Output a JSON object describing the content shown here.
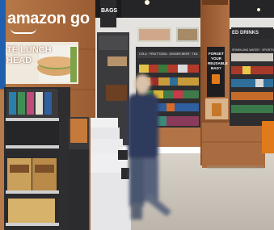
{
  "store_sign": {
    "brand": "amazon go"
  },
  "menu_board": {
    "line1": "TE LUNCH",
    "line2": "HEAD"
  },
  "wall_labels": {
    "bags": "BAGS",
    "drinks_center": "COLA · FRUIT SODA · GINGER BEER · TEA",
    "drinks_right": "SPARKLING WATER · SPORTS",
    "drinks_corner": "ED DRINKS"
  },
  "promo_poster": {
    "line1": "FORGET",
    "line2": "YOUR",
    "line3": "REUSABLE",
    "line4": "BAG?"
  },
  "colors": {
    "wood": "#a8683c",
    "ceiling": "#1c1c1e",
    "floor": "#c9c2b8",
    "gate": "#e9e9ea",
    "shelf_dark": "#2a2a2c",
    "blue_bar": "#1f5fae",
    "person_jacket": "#2f3a5c"
  }
}
